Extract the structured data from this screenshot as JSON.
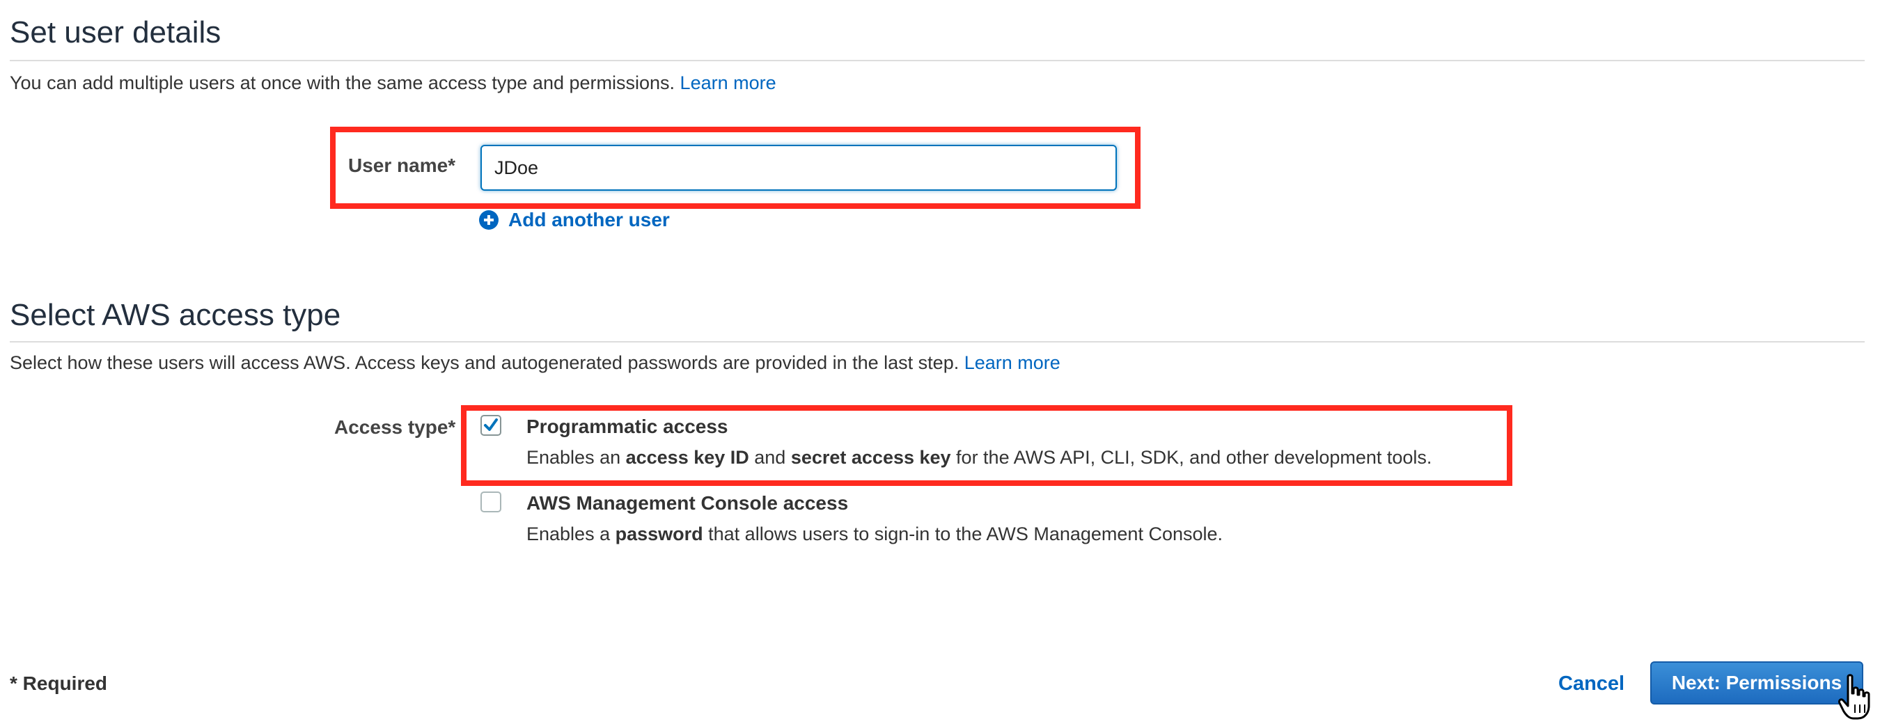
{
  "user_details": {
    "title": "Set user details",
    "description": "You can add multiple users at once with the same access type and permissions.",
    "learn_more": "Learn more",
    "user_name_label": "User name*",
    "user_name_value": "JDoe",
    "add_another_user": "Add another user"
  },
  "access_type": {
    "title": "Select AWS access type",
    "description": "Select how these users will access AWS. Access keys and autogenerated passwords are provided in the last step.",
    "learn_more": "Learn more",
    "label": "Access type*",
    "options": [
      {
        "title": "Programmatic access",
        "checked": true,
        "desc_prefix": "Enables an ",
        "desc_bold_1": "access key ID",
        "desc_mid": " and ",
        "desc_bold_2": "secret access key",
        "desc_suffix": " for the AWS API, CLI, SDK, and other development tools."
      },
      {
        "title": "AWS Management Console access",
        "checked": false,
        "desc_prefix": "Enables a ",
        "desc_bold_1": "password",
        "desc_suffix": " that allows users to sign-in to the AWS Management Console."
      }
    ]
  },
  "footer": {
    "required_note": "* Required",
    "cancel_label": "Cancel",
    "next_label": "Next: Permissions"
  },
  "colors": {
    "link": "#0066c0",
    "highlight": "#ff2a1f",
    "primary_button": "#1d6bbf",
    "checkmark": "#0073bb"
  },
  "icons": {
    "add_user": "plus-circle-icon",
    "checkbox_checked": "checkmark-icon",
    "cursor": "hand-pointer-icon"
  }
}
